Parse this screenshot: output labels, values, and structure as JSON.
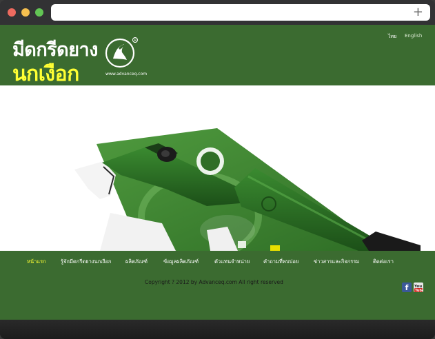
{
  "browser": {
    "new_tab_icon": "plus-icon"
  },
  "header": {
    "logo_line1": "มีดกรีดยาง",
    "logo_line2": "นกเงือก",
    "brand_url": "www.advanceq.com",
    "lang_thai": "ไทย",
    "lang_english": "English"
  },
  "nav": {
    "items": [
      {
        "label": "หน้าแรก",
        "active": true
      },
      {
        "label": "รู้จักมีดกรีดยางนกเงือก"
      },
      {
        "label": "ผลิตภัณฑ์"
      },
      {
        "label": "ข้อมูลผลิตภัณฑ์"
      },
      {
        "label": "ตัวแทนจำหน่าย"
      },
      {
        "label": "คำถามที่พบบ่อย"
      },
      {
        "label": "ข่าวสารและกิจกรรม"
      },
      {
        "label": "ติดต่อเรา"
      }
    ]
  },
  "footer": {
    "copyright": "Copyright ? 2012 by Advanceq.com All right reserved",
    "social": [
      "facebook-icon",
      "youtube-icon"
    ]
  },
  "colors": {
    "brand_green": "#3b6b30",
    "highlight_yellow": "#ffff33",
    "product_green": "#2e6f25"
  }
}
